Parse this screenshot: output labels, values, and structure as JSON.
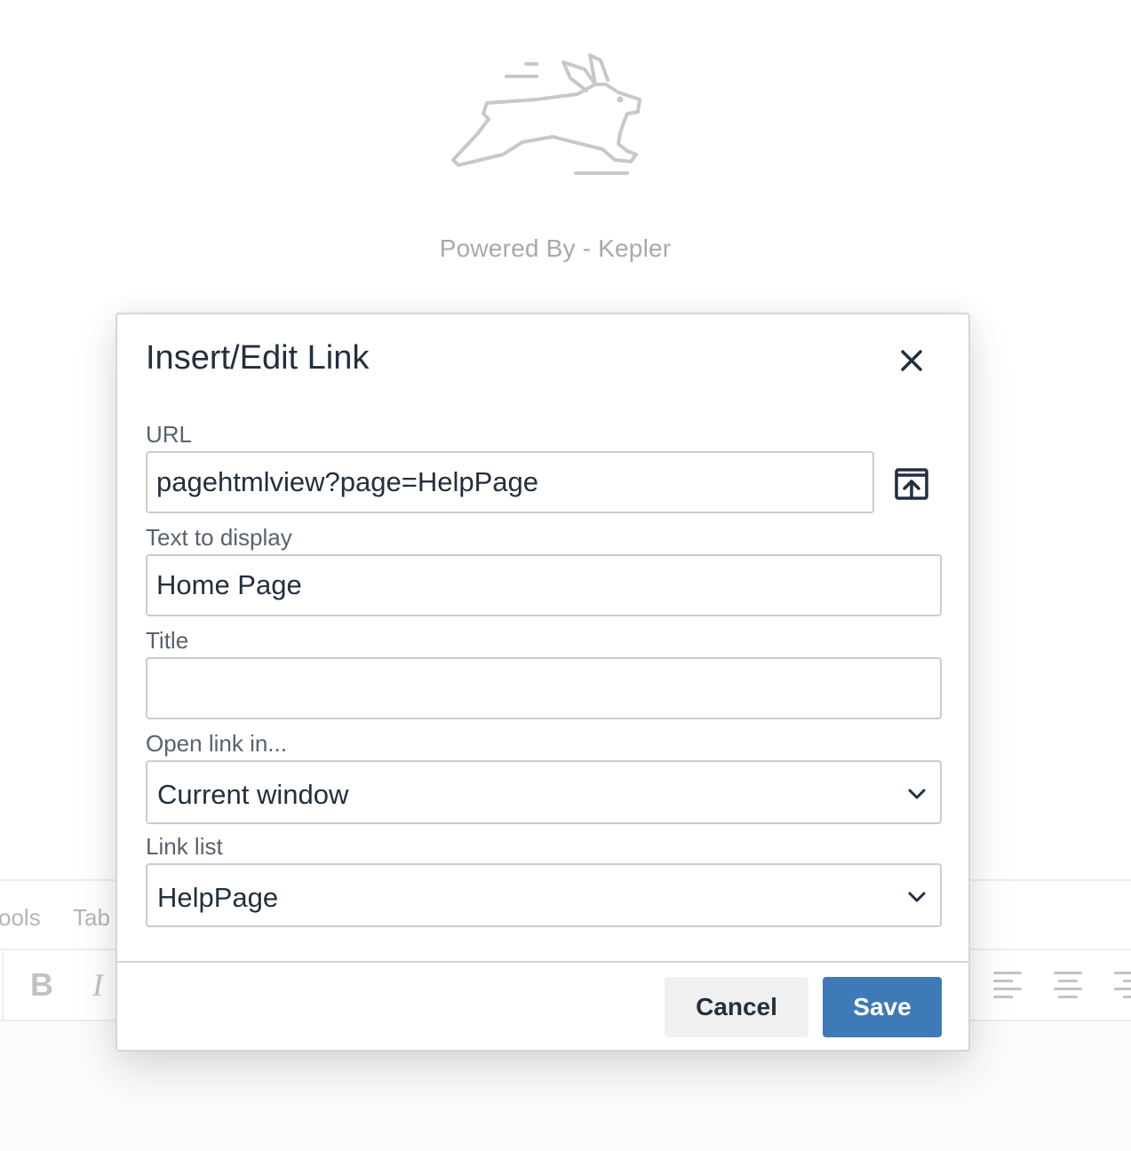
{
  "background": {
    "powered_by": "Powered By - Kepler",
    "menubar": {
      "items": [
        "ools",
        "Tab"
      ]
    },
    "toolbar": {
      "bold_label": "B",
      "italic_label": "I",
      "icons": [
        "bold-icon",
        "italic-icon",
        "align-left-icon",
        "align-center-icon",
        "align-right-icon"
      ]
    }
  },
  "dialog": {
    "title": "Insert/Edit Link",
    "close_icon": "close-icon",
    "url": {
      "label": "URL",
      "value": "pagehtmlview?page=HelpPage",
      "browse_icon": "upload-browse-icon"
    },
    "text_to_display": {
      "label": "Text to display",
      "value": "Home Page"
    },
    "title_field": {
      "label": "Title",
      "value": ""
    },
    "open_link_in": {
      "label": "Open link in...",
      "selected": "Current window"
    },
    "link_list": {
      "label": "Link list",
      "selected": "HelpPage"
    },
    "buttons": {
      "cancel": "Cancel",
      "save": "Save"
    }
  },
  "colors": {
    "primary": "#3e7ab7",
    "text": "#222f3e",
    "label": "#58626e",
    "border": "#cccccc"
  }
}
